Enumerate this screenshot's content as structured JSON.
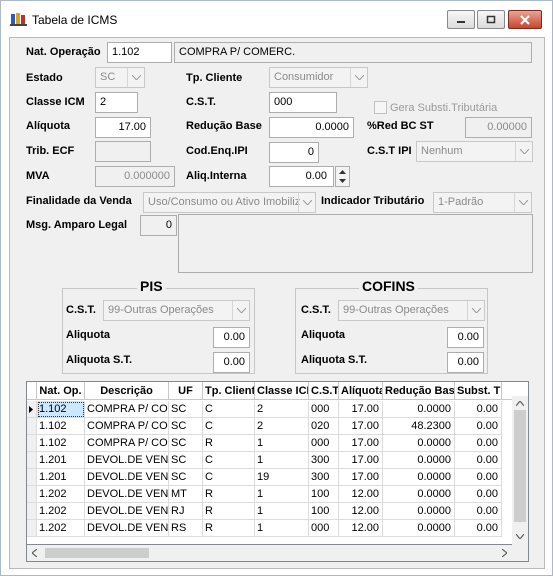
{
  "window": {
    "title": "Tabela de ICMS"
  },
  "form": {
    "nat_operacao": {
      "label": "Nat. Operação",
      "code": "1.102",
      "description": "COMPRA P/ COMERC."
    },
    "estado": {
      "label": "Estado",
      "value": "SC"
    },
    "tp_cliente": {
      "label": "Tp. Cliente",
      "value": "Consumidor"
    },
    "classe_icm": {
      "label": "Classe ICM",
      "value": "2"
    },
    "cst": {
      "label": "C.S.T.",
      "value": "000"
    },
    "gera_subst": {
      "label": "Gera Substi.Tributária",
      "checked": false
    },
    "aliquota": {
      "label": "Alíquota",
      "value": "17.00"
    },
    "reducao_base": {
      "label": "Redução Base",
      "value": "0.0000"
    },
    "red_bc_st": {
      "label": "%Red BC  ST",
      "value": "0.00000"
    },
    "trib_ecf": {
      "label": "Trib. ECF",
      "value": ""
    },
    "cod_enq_ipi": {
      "label": "Cod.Enq.IPI",
      "value": "0"
    },
    "cst_ipi": {
      "label": "C.S.T IPI",
      "value": "Nenhum"
    },
    "mva": {
      "label": "MVA",
      "value": "0.000000"
    },
    "aliq_interna": {
      "label": "Aliq.Interna",
      "value": "0.00"
    },
    "finalidade": {
      "label": "Finalidade da Venda",
      "value": "Uso/Consumo ou Ativo Imobiliz"
    },
    "indicador": {
      "label": "Indicador Tributário",
      "value": "1-Padrão"
    },
    "msg_amparo": {
      "label": "Msg. Amparo Legal",
      "value": "0",
      "text": ""
    }
  },
  "pis": {
    "title": "PIS",
    "cst_label": "C.S.T.",
    "cst_value": "99-Outras Operações",
    "aliq_label": "Aliquota",
    "aliq_value": "0.00",
    "aliq_st_label": "Aliquota S.T.",
    "aliq_st_value": "0.00"
  },
  "cofins": {
    "title": "COFINS",
    "cst_label": "C.S.T.",
    "cst_value": "99-Outras Operações",
    "aliq_label": "Aliquota",
    "aliq_value": "0.00",
    "aliq_st_label": "Aliquota S.T.",
    "aliq_st_value": "0.00"
  },
  "grid": {
    "columns": [
      "Nat. Op.",
      "Descrição",
      "UF",
      "Tp. Cliente",
      "Classe ICM",
      "C.S.T.",
      "Alíquota",
      "Redução Base",
      "Subst. T"
    ],
    "rows": [
      [
        "1.102",
        "COMPRA P/ COMERC.",
        "SC",
        "C",
        "2",
        "000",
        "17.00",
        "0.0000",
        "0.00"
      ],
      [
        "1.102",
        "COMPRA P/ COMERC.",
        "SC",
        "C",
        "2",
        "020",
        "17.00",
        "48.2300",
        "0.00"
      ],
      [
        "1.102",
        "COMPRA P/ COMERC.",
        "SC",
        "R",
        "1",
        "000",
        "17.00",
        "0.0000",
        "0.00"
      ],
      [
        "1.201",
        "DEVOL.DE VENDA",
        "SC",
        "C",
        "1",
        "300",
        "17.00",
        "0.0000",
        "0.00"
      ],
      [
        "1.201",
        "DEVOL.DE VENDA",
        "SC",
        "C",
        "19",
        "300",
        "17.00",
        "0.0000",
        "0.00"
      ],
      [
        "1.202",
        "DEVOL.DE VENDA",
        "MT",
        "R",
        "1",
        "100",
        "12.00",
        "0.0000",
        "0.00"
      ],
      [
        "1.202",
        "DEVOL.DE VENDA",
        "RJ",
        "R",
        "1",
        "100",
        "12.00",
        "0.0000",
        "0.00"
      ],
      [
        "1.202",
        "DEVOL.DE VENDA",
        "RS",
        "R",
        "1",
        "000",
        "12.00",
        "0.0000",
        "0.00"
      ]
    ]
  }
}
